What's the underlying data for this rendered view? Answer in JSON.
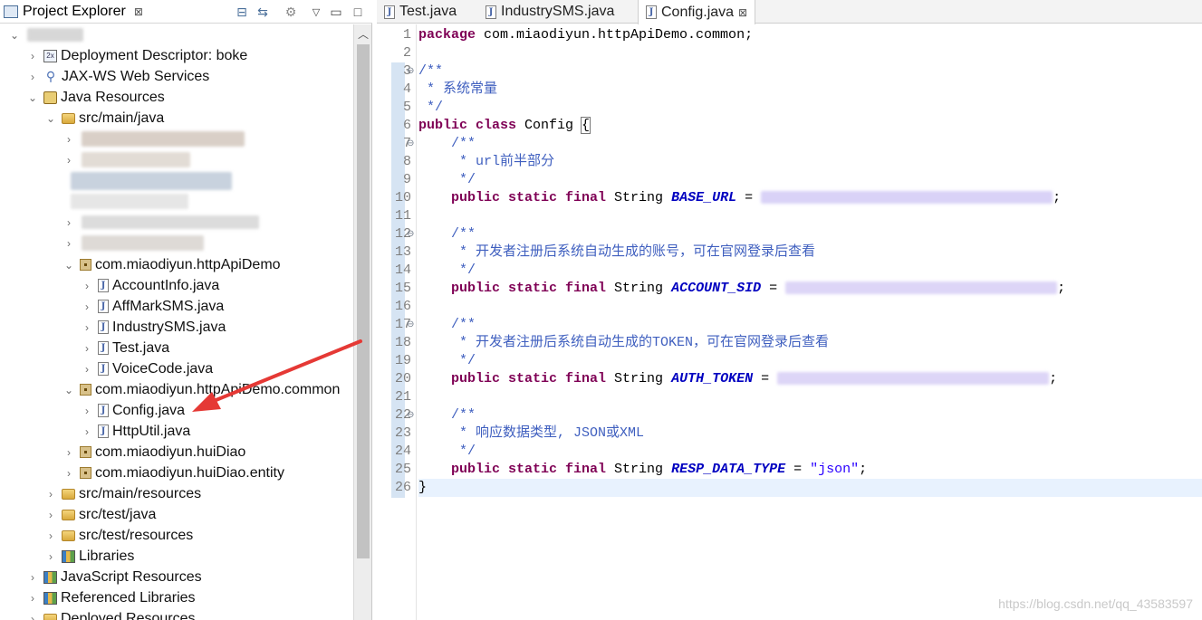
{
  "explorer": {
    "tab_title": "Project Explorer",
    "close_glyph": "⊠",
    "items": [
      {
        "label": "",
        "redacted": true
      },
      {
        "label": "Deployment Descriptor: boke"
      },
      {
        "label": "JAX-WS Web Services"
      },
      {
        "label": "Java Resources"
      },
      {
        "label": "src/main/java"
      },
      {
        "label": "com.miaodiyun.httpApiDemo"
      },
      {
        "label": "AccountInfo.java"
      },
      {
        "label": "AffMarkSMS.java"
      },
      {
        "label": "IndustrySMS.java"
      },
      {
        "label": "Test.java"
      },
      {
        "label": "VoiceCode.java"
      },
      {
        "label": "com.miaodiyun.httpApiDemo.common"
      },
      {
        "label": "Config.java"
      },
      {
        "label": "HttpUtil.java"
      },
      {
        "label": "com.miaodiyun.huiDiao"
      },
      {
        "label": "com.miaodiyun.huiDiao.entity"
      },
      {
        "label": "src/main/resources"
      },
      {
        "label": "src/test/java"
      },
      {
        "label": "src/test/resources"
      },
      {
        "label": "Libraries"
      },
      {
        "label": "JavaScript Resources"
      },
      {
        "label": "Referenced Libraries"
      },
      {
        "label": "Deployed Resources"
      }
    ]
  },
  "editor": {
    "tabs": [
      {
        "label": "Test.java"
      },
      {
        "label": "IndustrySMS.java"
      },
      {
        "label": "Config.java"
      }
    ],
    "line_numbers": [
      "1",
      "2",
      "3",
      "4",
      "5",
      "6",
      "7",
      "8",
      "9",
      "10",
      "11",
      "12",
      "13",
      "14",
      "15",
      "16",
      "17",
      "18",
      "19",
      "20",
      "21",
      "22",
      "23",
      "24",
      "25",
      "26"
    ],
    "code": {
      "l1_kw": "package",
      "l1_rest": " com.miaodiyun.httpApiDemo.common;",
      "l3": "/**",
      "l4": " * 系统常量",
      "l5": " */",
      "l6_kw": "public class",
      "l6_rest": " Config ",
      "l6_brace": "{",
      "l7": "    /**",
      "l8": "     * url前半部分",
      "l9": "     */",
      "kw_psf": "public static final",
      "type_string": " String ",
      "l10_field": "BASE_URL",
      "l12": "    /**",
      "l13": "     * 开发者注册后系统自动生成的账号，可在官网登录后查看",
      "l14": "     */",
      "l15_field": "ACCOUNT_SID",
      "l17": "    /**",
      "l18": "     * 开发者注册后系统自动生成的TOKEN，可在官网登录后查看",
      "l19": "     */",
      "l20_field": "AUTH_TOKEN",
      "l22": "    /**",
      "l23": "     * 响应数据类型, JSON或XML",
      "l24": "     */",
      "l25_field": "RESP_DATA_TYPE",
      "l25_value": "\"json\"",
      "eq": " = ",
      "semi": ";",
      "l26": "}"
    }
  },
  "watermark": "https://blog.csdn.net/qq_43583597",
  "colors": {
    "keyword": "#7f0055",
    "comment": "#3f5fbf",
    "field": "#0000c0",
    "string": "#2a00ff",
    "current_line": "#e8f2fe",
    "arrow": "#e53935"
  }
}
